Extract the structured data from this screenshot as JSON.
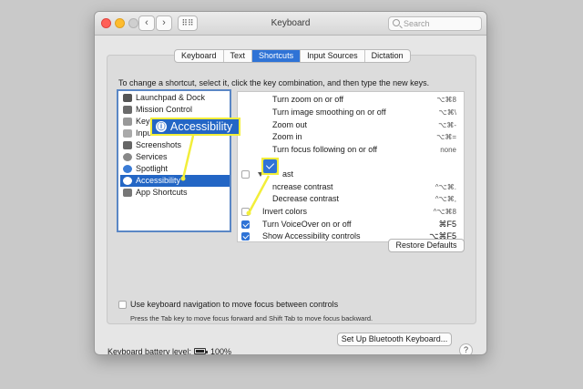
{
  "window": {
    "title": "Keyboard",
    "search_placeholder": "Search"
  },
  "tabs": [
    {
      "label": "Keyboard"
    },
    {
      "label": "Text"
    },
    {
      "label": "Shortcuts"
    },
    {
      "label": "Input Sources"
    },
    {
      "label": "Dictation"
    }
  ],
  "active_tab": "Shortcuts",
  "instructions": "To change a shortcut, select it, click the key combination, and then type the new keys.",
  "categories": [
    {
      "label": "Launchpad & Dock",
      "icon": "launchpad-icon"
    },
    {
      "label": "Mission Control",
      "icon": "mission-control-icon"
    },
    {
      "label": "Keyb",
      "icon": "keyboard-icon"
    },
    {
      "label": "Input",
      "icon": "input-sources-icon"
    },
    {
      "label": "Screenshots",
      "icon": "screenshots-icon"
    },
    {
      "label": "Services",
      "icon": "services-icon"
    },
    {
      "label": "Spotlight",
      "icon": "spotlight-icon"
    },
    {
      "label": "Accessibility",
      "icon": "accessibility-icon",
      "selected": true
    },
    {
      "label": "App Shortcuts",
      "icon": "app-shortcuts-icon"
    }
  ],
  "shortcuts": [
    {
      "label": "Turn zoom on or off",
      "key": "⌥⌘8",
      "checked": null
    },
    {
      "label": "Turn image smoothing on or off",
      "key": "⌥⌘\\",
      "checked": null
    },
    {
      "label": "Zoom out",
      "key": "⌥⌘-",
      "checked": null
    },
    {
      "label": "Zoom in",
      "key": "⌥⌘=",
      "checked": null
    },
    {
      "label": "Turn focus following on or off",
      "key": "none",
      "checked": null
    },
    {
      "label": "ast",
      "key": "",
      "checked": false
    },
    {
      "label": "ncrease contrast",
      "key": "^⌥⌘.",
      "checked": null
    },
    {
      "label": "Decrease contrast",
      "key": "^⌥⌘,",
      "checked": null
    },
    {
      "label": "Invert colors",
      "key": "^⌥⌘8",
      "checked": false
    },
    {
      "label": "Turn VoiceOver on or off",
      "key": "⌘F5",
      "checked": true
    },
    {
      "label": "Show Accessibility controls",
      "key": "⌥⌘F5",
      "checked": true
    }
  ],
  "restore_defaults": "Restore Defaults",
  "keyboard_navigation": {
    "label": "Use keyboard navigation to move focus between controls",
    "checked": false,
    "hint": "Press the Tab key to move focus forward and Shift Tab to move focus backward."
  },
  "battery": {
    "label": "Keyboard battery level:",
    "value": "100%"
  },
  "bluetooth_button": "Set Up Bluetooth Keyboard...",
  "help": "?",
  "callout": {
    "label": "Accessibility",
    "color": "#f2ee3a"
  },
  "colors": {
    "accent": "#2f73d6",
    "selection": "#2366c5",
    "callout_border": "#f2ee3a"
  }
}
